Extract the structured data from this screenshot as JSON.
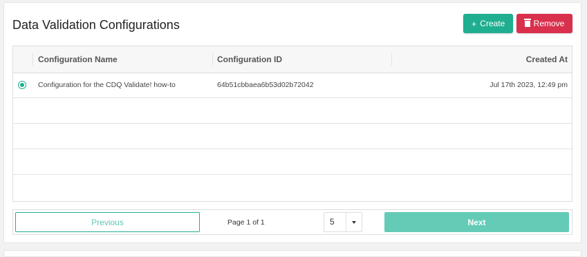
{
  "page": {
    "title": "Data Validation Configurations"
  },
  "toolbar": {
    "create_icon": "+",
    "create_label": "Create",
    "remove_label": "Remove"
  },
  "table": {
    "columns": [
      "Configuration Name",
      "Configuration ID",
      "Created At"
    ],
    "rows": [
      {
        "selected": true,
        "name": "Configuration for the CDQ Validate! how-to",
        "id": "64b51cbbaea6b53d02b72042",
        "created": "Jul 17th 2023, 12:49 pm"
      }
    ]
  },
  "pagination": {
    "previous_label": "Previous",
    "page_info": "Page 1 of 1",
    "page_size": "5",
    "next_label": "Next"
  },
  "colors": {
    "accent": "#1fae90",
    "danger": "#d9304d"
  }
}
